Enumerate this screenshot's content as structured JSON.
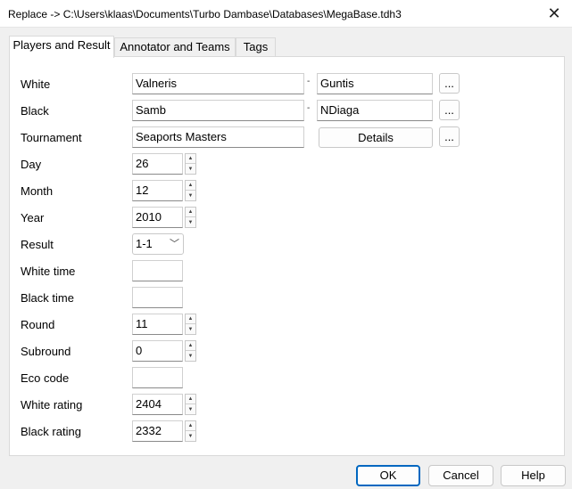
{
  "window": {
    "title": "Replace -> C:\\Users\\klaas\\Documents\\Turbo Dambase\\Databases\\MegaBase.tdh3",
    "close_glyph": "✕"
  },
  "tabs": [
    {
      "label": "Players and Result",
      "active": true
    },
    {
      "label": "Annotator and Teams",
      "active": false
    },
    {
      "label": "Tags",
      "active": false
    }
  ],
  "form": {
    "white": {
      "label": "White",
      "first": "Valneris",
      "last": "Guntis"
    },
    "black": {
      "label": "Black",
      "first": "Samb",
      "last": "NDiaga"
    },
    "tournament": {
      "label": "Tournament",
      "value": "Seaports Masters",
      "details_label": "Details"
    },
    "ellipsis_label": "...",
    "name_separator": "-",
    "day": {
      "label": "Day",
      "value": "26"
    },
    "month": {
      "label": "Month",
      "value": "12"
    },
    "year": {
      "label": "Year",
      "value": "2010"
    },
    "result": {
      "label": "Result",
      "value": "1-1"
    },
    "white_time": {
      "label": "White time",
      "value": ""
    },
    "black_time": {
      "label": "Black time",
      "value": ""
    },
    "round": {
      "label": "Round",
      "value": "11"
    },
    "subround": {
      "label": "Subround",
      "value": "0"
    },
    "eco_code": {
      "label": "Eco code",
      "value": ""
    },
    "white_rating": {
      "label": "White rating",
      "value": "2404"
    },
    "black_rating": {
      "label": "Black rating",
      "value": "2332"
    }
  },
  "footer": {
    "ok_label": "OK",
    "cancel_label": "Cancel",
    "help_label": "Help"
  }
}
